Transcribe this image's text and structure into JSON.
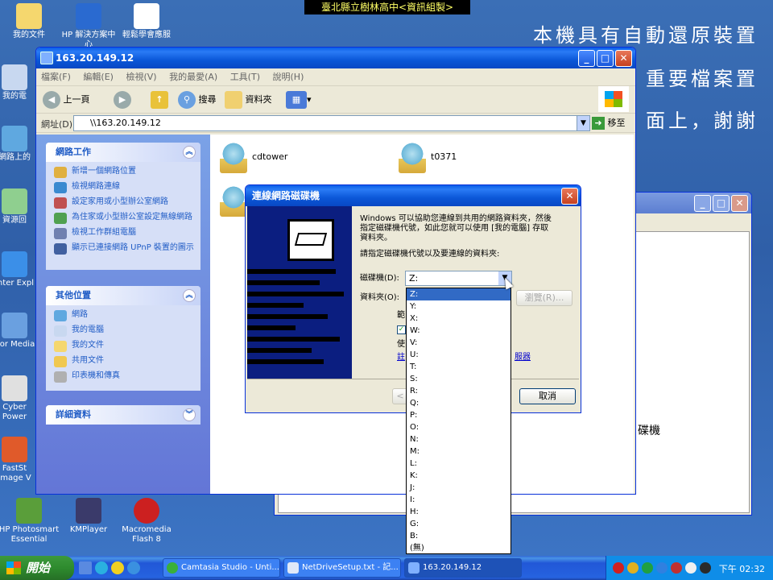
{
  "banner": "臺北縣立樹林高中<資訊組製>",
  "overlay": [
    "本機具有自動還原裝置",
    "重要檔案置",
    "面上，謝謝",
    "碟機"
  ],
  "desktop_icons": [
    {
      "label": "我的文件",
      "color": "#f5d76e"
    },
    {
      "label": "HP 解決方案中心",
      "color": "#2a6ad0"
    },
    {
      "label": "輕鬆學會應服",
      "color": "#ffffff"
    },
    {
      "label": "我的電",
      "color": "#c8d8f0"
    },
    {
      "label": "網路上的",
      "color": "#5fa8e0"
    },
    {
      "label": "資源回",
      "color": "#8fcf8f"
    },
    {
      "label": "Inter Expl",
      "color": "#3b8fe8"
    },
    {
      "label": "Cor Media",
      "color": "#6aa0e0"
    },
    {
      "label": "Cyber Power",
      "color": "#e0e0e0"
    },
    {
      "label": "FastSt Image V",
      "color": "#e05a2a"
    },
    {
      "label": "HP Photosmart Essential",
      "color": "#5a9e3a"
    },
    {
      "label": "KMPlayer",
      "color": "#3a3a6a"
    },
    {
      "label": "Macromedia Flash 8",
      "color": "#cc2020"
    }
  ],
  "explorer": {
    "title": "163.20.149.12",
    "menu": [
      "檔案(F)",
      "編輯(E)",
      "檢視(V)",
      "我的最愛(A)",
      "工具(T)",
      "說明(H)"
    ],
    "toolbar": {
      "back": "上一頁",
      "search": "搜尋",
      "folders": "資料夾"
    },
    "address_label": "網址(D)",
    "address_value": "\\\\163.20.149.12",
    "go": "移至",
    "tasks_header": "網路工作",
    "tasks": [
      "新增一個網路位置",
      "檢視網路連線",
      "設定家用或小型辦公室網路",
      "為住家或小型辦公室設定無線網路",
      "檢視工作群組電腦",
      "顯示已連接網路 UPnP 裝置的圖示"
    ],
    "places_header": "其他位置",
    "places": [
      "網路",
      "我的電腦",
      "我的文件",
      "共用文件",
      "印表機和傳真"
    ],
    "details_header": "詳細資料",
    "folders": [
      "cdtower",
      "t0371"
    ]
  },
  "dialog": {
    "title": "連線網路磁碟機",
    "intro": [
      "Windows 可以協助您連線到共用的網路資料夾，然後",
      "指定磁碟機代號，如此您就可以使用 [我的電腦] 存取",
      "資料夾。"
    ],
    "prompt": "請指定磁碟機代號以及要連線的資料夾:",
    "drive_label": "磁碟機(D):",
    "drive_value": "Z:",
    "folder_label": "資料夾(O):",
    "browse": "瀏覽(R)...",
    "partial": [
      "範",
      "使",
      "註"
    ],
    "link_tail": "服器",
    "back": "<",
    "cancel": "取消"
  },
  "drive_options": [
    "Z:",
    "Y:",
    "X:",
    "W:",
    "V:",
    "U:",
    "T:",
    "S:",
    "R:",
    "Q:",
    "P:",
    "O:",
    "N:",
    "M:",
    "L:",
    "K:",
    "J:",
    "I:",
    "H:",
    "G:",
    "B:",
    "(無)"
  ],
  "taskbar": {
    "start": "開始",
    "tasks": [
      "Camtasia Studio - Unti...",
      "NetDriveSetup.txt - 記...",
      "163.20.149.12"
    ],
    "clock": "下午 02:32"
  }
}
